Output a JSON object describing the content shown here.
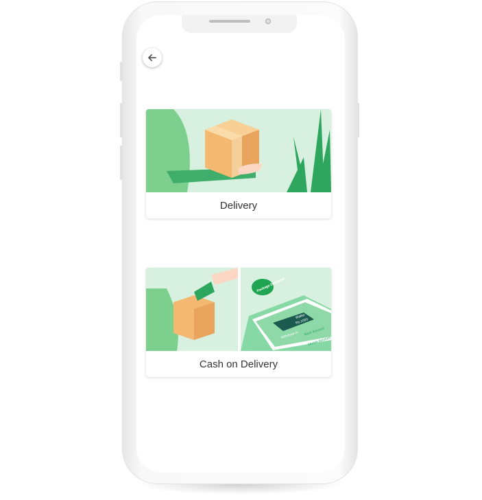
{
  "back_button": {
    "icon": "arrow-left-icon"
  },
  "options": [
    {
      "label": "Delivery",
      "illustration": "package-hand-plant"
    },
    {
      "label": "Cash on Delivery",
      "illustration": "cash-package-phone-wallet",
      "illustration_text": {
        "bubble": "Package Delivered",
        "wallet": "Wallet",
        "amount": "Rs.1000",
        "withdraw": "Withdraw in:",
        "bank": "Bank Account",
        "mobile": "Mobile Account"
      }
    }
  ],
  "colors": {
    "accent": "#2db36a",
    "illustration_bg": "#d9f1e2",
    "box": "#f4b870"
  }
}
